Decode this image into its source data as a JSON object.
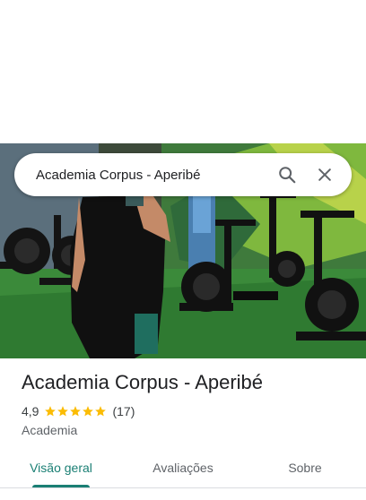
{
  "search": {
    "query": "Academia Corpus - Aperibé",
    "search_icon": "search-icon",
    "close_icon": "close-icon"
  },
  "place": {
    "name": "Academia Corpus - Aperibé",
    "rating": "4,9",
    "rating_stars": 5,
    "reviews_count": "(17)",
    "category": "Academia"
  },
  "tabs": [
    {
      "label": "Visão geral",
      "active": true
    },
    {
      "label": "Avaliações",
      "active": false
    },
    {
      "label": "Sobre",
      "active": false
    }
  ],
  "colors": {
    "accent": "#1a7f74",
    "star": "#fbbc04",
    "text_primary": "#202124",
    "text_secondary": "#5f6368"
  }
}
